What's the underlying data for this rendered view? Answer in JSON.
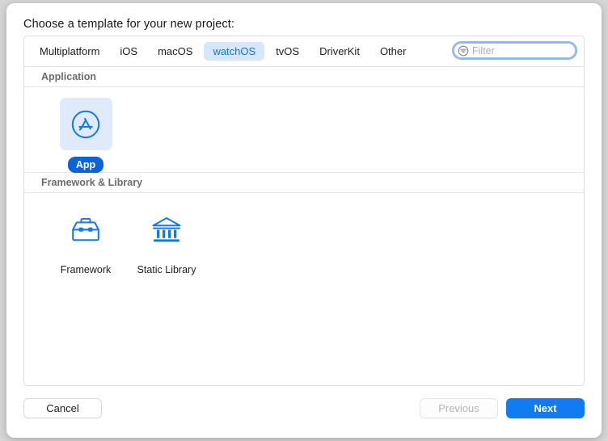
{
  "dialog": {
    "title": "Choose a template for your new project:"
  },
  "tabs": [
    {
      "label": "Multiplatform",
      "selected": false
    },
    {
      "label": "iOS",
      "selected": false
    },
    {
      "label": "macOS",
      "selected": false
    },
    {
      "label": "watchOS",
      "selected": true
    },
    {
      "label": "tvOS",
      "selected": false
    },
    {
      "label": "DriverKit",
      "selected": false
    },
    {
      "label": "Other",
      "selected": false
    }
  ],
  "filter": {
    "icon": "filter-lines-circle-icon",
    "value": "",
    "placeholder": "Filter",
    "focused": true
  },
  "sections": [
    {
      "header": "Application",
      "items": [
        {
          "label": "App",
          "icon": "app-store-icon",
          "selected": true
        }
      ]
    },
    {
      "header": "Framework & Library",
      "items": [
        {
          "label": "Framework",
          "icon": "toolbox-icon",
          "selected": false
        },
        {
          "label": "Static Library",
          "icon": "bank-columns-icon",
          "selected": false
        }
      ]
    }
  ],
  "footer": {
    "cancel_label": "Cancel",
    "previous_label": "Previous",
    "next_label": "Next"
  },
  "colors": {
    "accent_blue": "#117cf2",
    "icon_blue": "#1178f0",
    "tab_selected_bg": "#d6e6fb",
    "tile_selected_bg": "#dfeafa",
    "label_pill_bg": "#0b63d6",
    "focus_ring": "#86b9f7",
    "backdrop": "#d6d6d6"
  }
}
